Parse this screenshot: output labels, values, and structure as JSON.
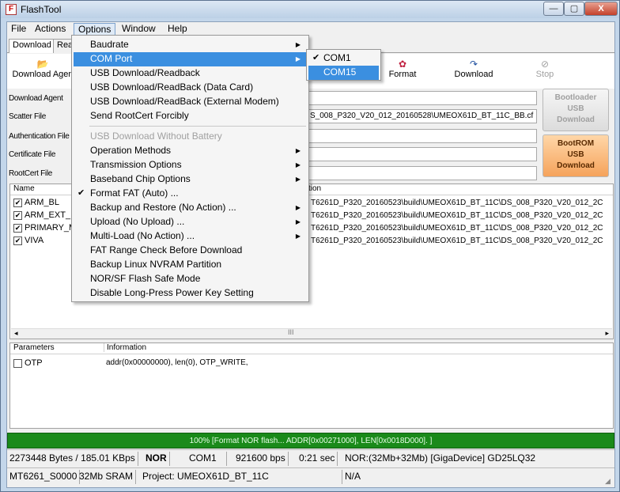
{
  "window": {
    "title": "FlashTool",
    "min": "—",
    "max": "▢",
    "close": "X"
  },
  "menubar": [
    "File",
    "Actions",
    "Options",
    "Window",
    "Help"
  ],
  "tabs": {
    "download": "Download",
    "readback_partial": "Rea"
  },
  "toolbar": {
    "download_agent": "Download Agen",
    "format": "Format",
    "download": "Download",
    "stop": "Stop"
  },
  "fields": {
    "download_agent_label": "Download Agent",
    "scatter_label": "Scatter File",
    "scatter_value": "S_008_P320_V20_012_20160528\\UMEOX61D_BT_11C_BB.cf",
    "auth_label": "Authentication File",
    "cert_label": "Certificate File",
    "rootcert_label": "RootCert File"
  },
  "side_buttons": {
    "bootloader": [
      "Bootloader",
      "USB",
      "Download"
    ],
    "bootrom": [
      "BootROM",
      "USB",
      "Download"
    ]
  },
  "list": {
    "col_name": "Name",
    "col_location": "tion",
    "rows": [
      {
        "name": "ARM_BL",
        "location": "T6261D_P320_20160523\\build\\UMEOX61D_BT_11C\\DS_008_P320_V20_012_2C"
      },
      {
        "name": "ARM_EXT_B",
        "location": "T6261D_P320_20160523\\build\\UMEOX61D_BT_11C\\DS_008_P320_V20_012_2C"
      },
      {
        "name": "PRIMARY_M",
        "location": "T6261D_P320_20160523\\build\\UMEOX61D_BT_11C\\DS_008_P320_V20_012_2C"
      },
      {
        "name": "VIVA",
        "location": "T6261D_P320_20160523\\build\\UMEOX61D_BT_11C\\DS_008_P320_V20_012_2C"
      }
    ],
    "scroll_center": "III"
  },
  "params": {
    "col_parameters": "Parameters",
    "col_information": "Information",
    "rows": [
      {
        "name": "OTP",
        "info": "addr(0x00000000), len(0), OTP_WRITE,"
      }
    ]
  },
  "progress": {
    "percent": 100,
    "text": "100% [Format NOR flash... ADDR[0x00271000], LEN[0x0018D000]. ]"
  },
  "status1": {
    "bytes": "2273448 Bytes / 185.01 KBps",
    "type": "NOR",
    "port": "COM1",
    "baud": "921600 bps",
    "time": "0:21 sec",
    "flash": "NOR:(32Mb+32Mb) [GigaDevice] GD25LQ32"
  },
  "status2": {
    "chip": "MT6261_S0000",
    "sram": "32Mb SRAM",
    "project": "Project: UMEOX61D_BT_11C",
    "na": "N/A"
  },
  "options_menu": {
    "items": [
      {
        "label": "Baudrate",
        "submenu": true
      },
      {
        "label": "COM Port",
        "submenu": true,
        "highlighted": true
      },
      {
        "label": "USB Download/Readback"
      },
      {
        "label": "USB Download/ReadBack (Data Card)"
      },
      {
        "label": "USB Download/ReadBack (External Modem)"
      },
      {
        "label": "Send RootCert Forcibly"
      },
      {
        "label": "USB Download Without Battery",
        "disabled": true
      },
      {
        "label": "Operation Methods",
        "submenu": true
      },
      {
        "label": "Transmission Options",
        "submenu": true
      },
      {
        "label": "Baseband Chip Options",
        "submenu": true
      },
      {
        "label": "Format FAT (Auto) ...",
        "checked": true
      },
      {
        "label": "Backup and Restore (No Action) ...",
        "submenu": true
      },
      {
        "label": "Upload (No Upload) ...",
        "submenu": true
      },
      {
        "label": "Multi-Load (No Action) ...",
        "submenu": true
      },
      {
        "label": "FAT Range Check Before Download"
      },
      {
        "label": "Backup Linux NVRAM Partition"
      },
      {
        "label": "NOR/SF Flash Safe Mode"
      },
      {
        "label": "Disable Long-Press Power Key Setting"
      }
    ]
  },
  "com_submenu": {
    "items": [
      {
        "label": "COM1",
        "checked": true
      },
      {
        "label": "COM15",
        "highlighted": true
      }
    ]
  }
}
